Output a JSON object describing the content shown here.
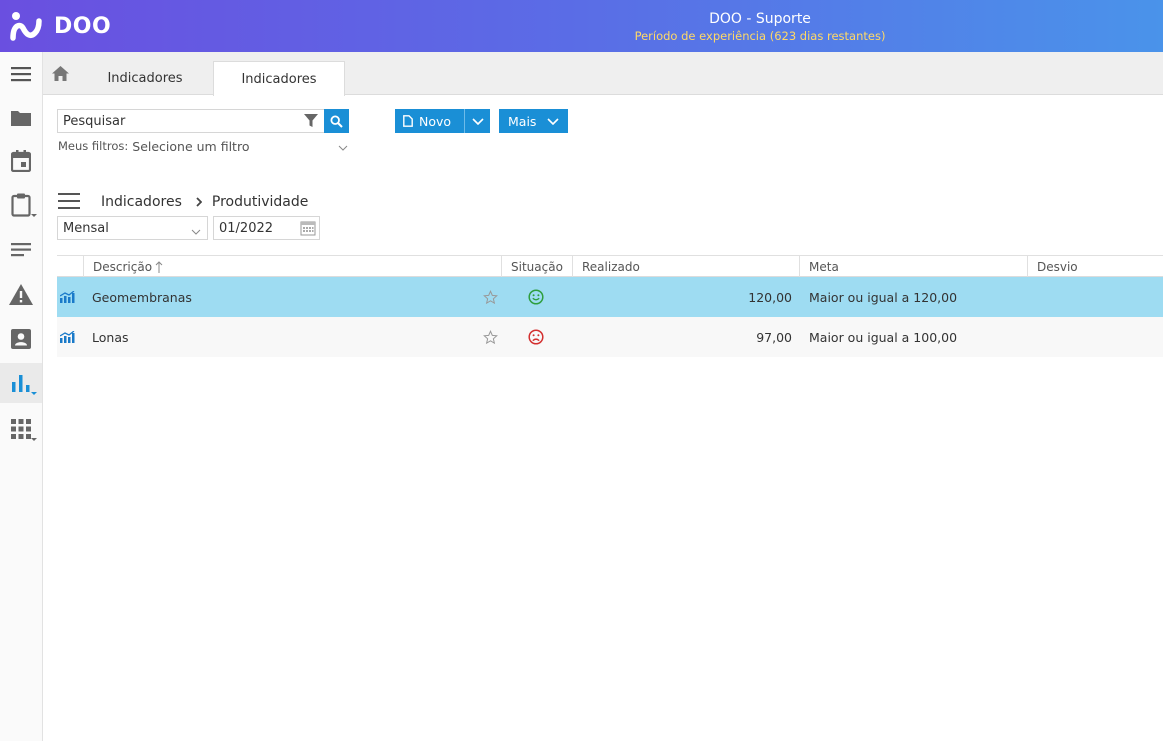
{
  "app": {
    "logo_text": "DOO",
    "title": "DOO - Suporte",
    "subtitle": "Período de experiência (623 dias restantes)"
  },
  "sidebar": {
    "items": [
      {
        "icon": "hamburger-icon"
      },
      {
        "icon": "folder-icon"
      },
      {
        "icon": "calendar-icon"
      },
      {
        "icon": "clipboard-icon"
      },
      {
        "icon": "lines-icon"
      },
      {
        "icon": "warning-icon"
      },
      {
        "icon": "contact-card-icon"
      },
      {
        "icon": "bar-chart-icon",
        "active": true
      },
      {
        "icon": "grid-icon"
      }
    ]
  },
  "tabs": {
    "home_icon": "home-icon",
    "items": [
      {
        "label": "Indicadores"
      },
      {
        "label": "Indicadores",
        "active": true
      }
    ]
  },
  "search": {
    "placeholder": "Pesquisar",
    "filters_label": "Meus filtros:",
    "filters_value": "Selecione um filtro"
  },
  "toolbar": {
    "new_label": "Novo",
    "more_label": "Mais"
  },
  "breadcrumb": {
    "root": "Indicadores",
    "current": "Produtividade"
  },
  "period": {
    "frequency": "Mensal",
    "date": "01/2022"
  },
  "table": {
    "columns": [
      "Descrição",
      "Situação",
      "Realizado",
      "Meta",
      "Desvio"
    ],
    "rows": [
      {
        "description": "Geomembranas",
        "status": "happy",
        "realized": "120,00",
        "target": "Maior ou igual a 120,00",
        "deviation": "",
        "selected": true
      },
      {
        "description": "Lonas",
        "status": "sad",
        "realized": "97,00",
        "target": "Maior ou igual a 100,00",
        "deviation": "",
        "selected": false
      }
    ]
  },
  "colors": {
    "accent": "#1a8fd6",
    "selected_row": "#9edcf2",
    "status_ok": "#2e9e3e",
    "status_bad": "#d32f2f",
    "trial_text": "#ffd966"
  }
}
